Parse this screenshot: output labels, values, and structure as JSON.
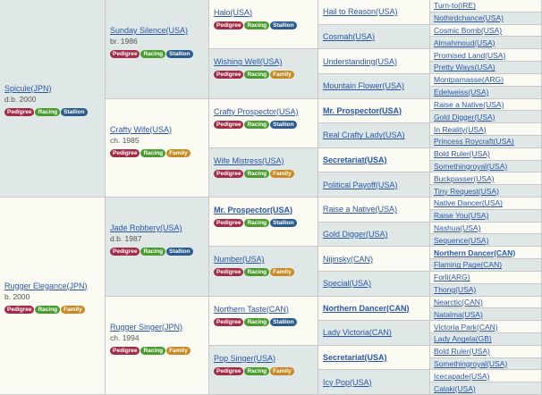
{
  "badges": {
    "pedigree": "Pedigree",
    "racing": "Racing",
    "stallion": "Stallion",
    "family": "Family"
  },
  "gen1": [
    {
      "name": "Spicule(JPN)",
      "info": "d.b. 2000",
      "tags": [
        "pedigree",
        "racing",
        "stallion"
      ]
    },
    {
      "name": "Rugger Elegance(JPN)",
      "info": "b. 2000",
      "tags": [
        "pedigree",
        "racing",
        "family"
      ]
    }
  ],
  "gen2": [
    {
      "name": "Sunday Silence(USA)",
      "info": "br. 1986",
      "tags": [
        "pedigree",
        "racing",
        "stallion"
      ]
    },
    {
      "name": "Crafty Wife(USA)",
      "info": "ch. 1985",
      "tags": [
        "pedigree",
        "racing",
        "family"
      ]
    },
    {
      "name": "Jade Robbery(USA)",
      "info": "d.b. 1987",
      "tags": [
        "pedigree",
        "racing",
        "stallion"
      ]
    },
    {
      "name": "Rugger Singer(JPN)",
      "info": "ch. 1994",
      "tags": [
        "pedigree",
        "racing",
        "family"
      ]
    }
  ],
  "gen3": [
    {
      "name": "Halo(USA)",
      "tags": [
        "pedigree",
        "racing",
        "stallion"
      ]
    },
    {
      "name": "Wishing Well(USA)",
      "tags": [
        "pedigree",
        "racing",
        "family"
      ]
    },
    {
      "name": "Crafty Prospector(USA)",
      "tags": [
        "pedigree",
        "racing",
        "stallion"
      ]
    },
    {
      "name": "Wife Mistress(USA)",
      "tags": [
        "pedigree",
        "racing",
        "family"
      ]
    },
    {
      "name": "Mr. Prospector(USA)",
      "bold": true,
      "tags": [
        "pedigree",
        "racing",
        "stallion"
      ]
    },
    {
      "name": "Number(USA)",
      "tags": [
        "pedigree",
        "racing",
        "family"
      ]
    },
    {
      "name": "Northern Taste(CAN)",
      "tags": [
        "pedigree",
        "racing",
        "stallion"
      ]
    },
    {
      "name": "Pop Singer(USA)",
      "tags": [
        "pedigree",
        "racing",
        "family"
      ]
    }
  ],
  "gen4": [
    {
      "name": "Hail to Reason(USA)"
    },
    {
      "name": "Cosmah(USA)"
    },
    {
      "name": "Understanding(USA)"
    },
    {
      "name": "Mountain Flower(USA)"
    },
    {
      "name": "Mr. Prospector(USA)",
      "bold": true
    },
    {
      "name": "Real Crafty Lady(USA)"
    },
    {
      "name": "Secretariat(USA)",
      "bold": true
    },
    {
      "name": "Political Payoff(USA)"
    },
    {
      "name": "Raise a Native(USA)"
    },
    {
      "name": "Gold Digger(USA)"
    },
    {
      "name": "Nijinsky(CAN)"
    },
    {
      "name": "Special(USA)"
    },
    {
      "name": "Northern Dancer(CAN)",
      "bold": true
    },
    {
      "name": "Lady Victoria(CAN)"
    },
    {
      "name": "Secretariat(USA)",
      "bold": true
    },
    {
      "name": "Icy Pop(USA)"
    }
  ],
  "gen5": [
    {
      "name": "Turn-to(IRE)"
    },
    {
      "name": "Nothirdchance(USA)"
    },
    {
      "name": "Cosmic Bomb(USA)"
    },
    {
      "name": "Almahmoud(USA)"
    },
    {
      "name": "Promised Land(USA)"
    },
    {
      "name": "Pretty Ways(USA)"
    },
    {
      "name": "Montparnasse(ARG)"
    },
    {
      "name": "Edelweiss(USA)"
    },
    {
      "name": "Raise a Native(USA)"
    },
    {
      "name": "Gold Digger(USA)"
    },
    {
      "name": "In Reality(USA)"
    },
    {
      "name": "Princess Roycraft(USA)"
    },
    {
      "name": "Bold Ruler(USA)"
    },
    {
      "name": "Somethingroyal(USA)"
    },
    {
      "name": "Buckpasser(USA)"
    },
    {
      "name": "Tiny Request(USA)"
    },
    {
      "name": "Native Dancer(USA)"
    },
    {
      "name": "Raise You(USA)"
    },
    {
      "name": "Nashua(USA)"
    },
    {
      "name": "Sequence(USA)"
    },
    {
      "name": "Northern Dancer(CAN)",
      "bold": true
    },
    {
      "name": "Flaming Page(CAN)"
    },
    {
      "name": "Forli(ARG)"
    },
    {
      "name": "Thong(USA)"
    },
    {
      "name": "Nearctic(CAN)"
    },
    {
      "name": "Natalma(USA)"
    },
    {
      "name": "Victoria Park(CAN)"
    },
    {
      "name": "Lady Angela(GB)"
    },
    {
      "name": "Bold Ruler(USA)"
    },
    {
      "name": "Somethingroyal(USA)"
    },
    {
      "name": "Icecapade(USA)"
    },
    {
      "name": "Calaki(USA)"
    }
  ]
}
